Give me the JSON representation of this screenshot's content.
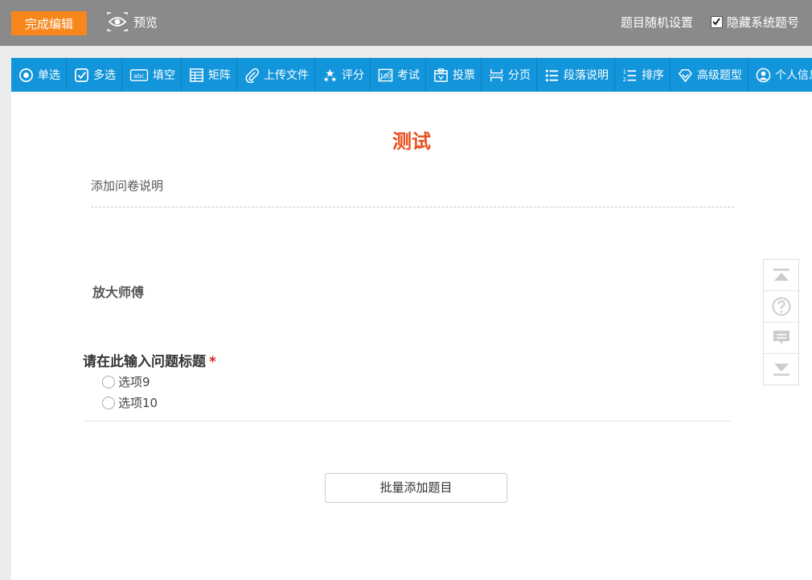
{
  "topbar": {
    "finish_label": "完成编辑",
    "preview_label": "预览",
    "random_label": "题目随机设置",
    "hide_number_label": "隐藏系统题号",
    "hide_number_checked": true
  },
  "toolbar": {
    "items": [
      {
        "label": "单选",
        "icon": "radio-icon"
      },
      {
        "label": "多选",
        "icon": "checkbox-icon"
      },
      {
        "label": "填空",
        "icon": "fill-blank-icon"
      },
      {
        "label": "矩阵",
        "icon": "matrix-icon"
      },
      {
        "label": "上传文件",
        "icon": "paperclip-icon"
      },
      {
        "label": "评分",
        "icon": "stars-icon"
      },
      {
        "label": "考试",
        "icon": "exam-icon"
      },
      {
        "label": "投票",
        "icon": "ballot-box-icon"
      },
      {
        "label": "分页",
        "icon": "page-break-icon"
      },
      {
        "label": "段落说明",
        "icon": "list-icon"
      },
      {
        "label": "排序",
        "icon": "sort-icon"
      },
      {
        "label": "高级题型",
        "icon": "diamond-icon"
      },
      {
        "label": "个人信息",
        "icon": "user-icon"
      }
    ]
  },
  "survey": {
    "title": "测试",
    "description": "添加问卷说明",
    "paragraph": "放大师傅",
    "question": {
      "title": "请在此输入问题标题",
      "required_mark": "*",
      "options": [
        "选项9",
        "选项10"
      ]
    },
    "batch_add_label": "批量添加题目"
  },
  "side_panel": {
    "icons": [
      "scroll-top-icon",
      "help-icon",
      "comment-icon",
      "scroll-bottom-icon"
    ]
  },
  "colors": {
    "topbar_bg": "#8a8a8a",
    "finish_button": "#f7861c",
    "toolbar_bg": "#1295db",
    "title": "#e8501e",
    "required": "#e02020"
  }
}
